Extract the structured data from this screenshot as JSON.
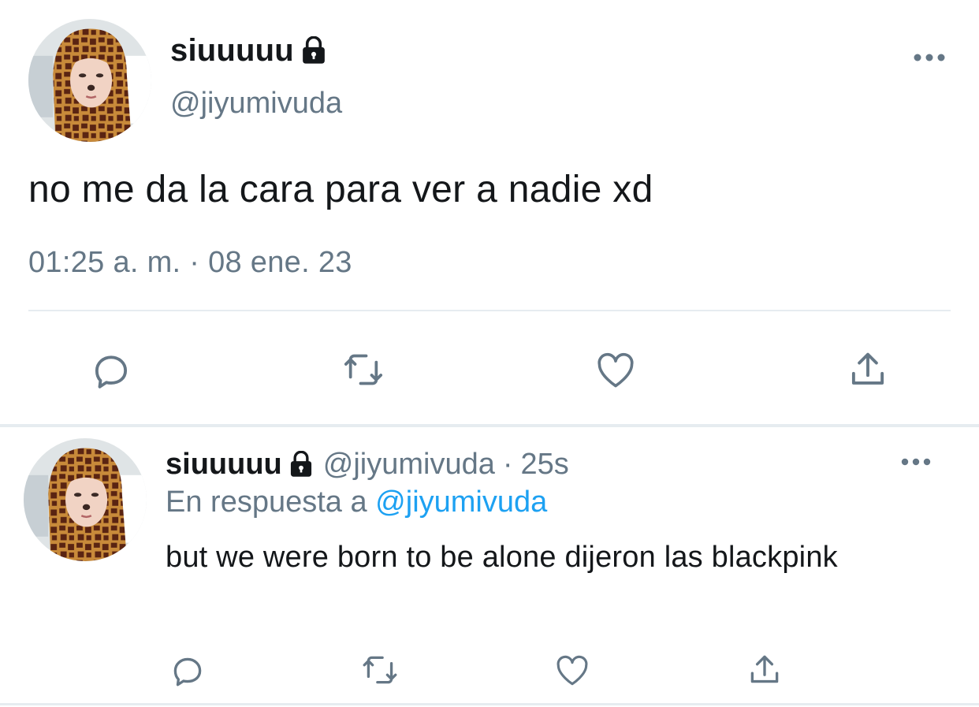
{
  "colors": {
    "primary_text": "#14171a",
    "secondary_text": "#657786",
    "link": "#1da1f2",
    "divider": "#e6ecf0",
    "icon": "#657786"
  },
  "main_tweet": {
    "display_name": "siuuuuu",
    "lock_icon": "lock-icon",
    "handle": "@jiyumivuda",
    "text": "no me da la cara para ver a nadie xd",
    "timestamp": "01:25 a. m. · 08 ene. 23",
    "more_icon": "more-options-icon",
    "actions": [
      "reply-icon",
      "retweet-icon",
      "like-icon",
      "share-icon"
    ]
  },
  "reply_tweet": {
    "display_name": "siuuuuu",
    "lock_icon": "lock-icon",
    "handle": "@jiyumivuda",
    "separator": "·",
    "time": "25s",
    "reply_prefix": "En respuesta a",
    "reply_to": "@jiyumivuda",
    "text": "but we were born to be alone dijeron las blackpink",
    "more_icon": "more-options-icon",
    "actions": [
      "reply-icon",
      "retweet-icon",
      "like-icon",
      "share-icon"
    ]
  }
}
